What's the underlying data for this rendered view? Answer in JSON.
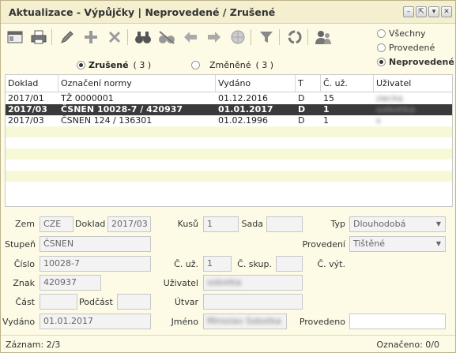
{
  "window": {
    "title": "Aktualizace - Výpůjčky | Neprovedené / Zrušené"
  },
  "filter_right": {
    "options": [
      "Všechny",
      "Provedené",
      "Neprovedené"
    ],
    "selected": "Neprovedené"
  },
  "subfilter": {
    "zrusene_label": "Zrušené",
    "zrusene_count": "( 3 )",
    "zmenene_label": "Změněné",
    "zmenene_count": "( 3 )",
    "selected": "Zrušené"
  },
  "grid": {
    "headers": [
      "Doklad",
      "Označení normy",
      "Vydáno",
      "T",
      "Č. už.",
      "Uživatel"
    ],
    "rows": [
      [
        "2017/01",
        "TŽ 0000001",
        "01.12.2016",
        "D",
        "15",
        "zwcka"
      ],
      [
        "2017/03",
        "ČSNEN 10028-7 / 420937",
        "01.01.2017",
        "D",
        "1",
        "sobotka"
      ],
      [
        "2017/03",
        "ČSNEN 124 / 136301",
        "01.02.1996",
        "D",
        "1",
        "s"
      ]
    ],
    "selected_row": 1
  },
  "form": {
    "zem_label": "Zem",
    "zem": "CZE",
    "doklad_label": "Doklad",
    "doklad": "2017/03",
    "kusu_label": "Kusů",
    "kusu": "1",
    "sada_label": "Sada",
    "sada": "",
    "typ_label": "Typ",
    "typ": "Dlouhodobá",
    "stupen_label": "Stupeň",
    "stupen": "ČSNEN",
    "provedeni_label": "Provedení",
    "provedeni": "Tištěné",
    "cislo_label": "Číslo",
    "cislo": "10028-7",
    "cuz_label": "Č. už.",
    "cuz": "1",
    "cskup_label": "Č. skup.",
    "cskup": "",
    "cvyt_label": "Č. výt.",
    "cvyt": "",
    "znak_label": "Znak",
    "znak": "420937",
    "uzivatel_label": "Uživatel",
    "uzivatel": "sobotka",
    "cast_label": "Část",
    "cast": "",
    "podcast_label": "Podčást",
    "podcast": "",
    "utvar_label": "Útvar",
    "utvar": "",
    "vydano_label": "Vydáno",
    "vydano": "01.01.2017",
    "jmeno_label": "Jméno",
    "jmeno": "Miroslav Sobotka",
    "provedeno_label": "Provedeno",
    "provedeno": ""
  },
  "status": {
    "zaznam": "Záznam: 2/3",
    "oznaceno": "Označeno: 0/0"
  }
}
